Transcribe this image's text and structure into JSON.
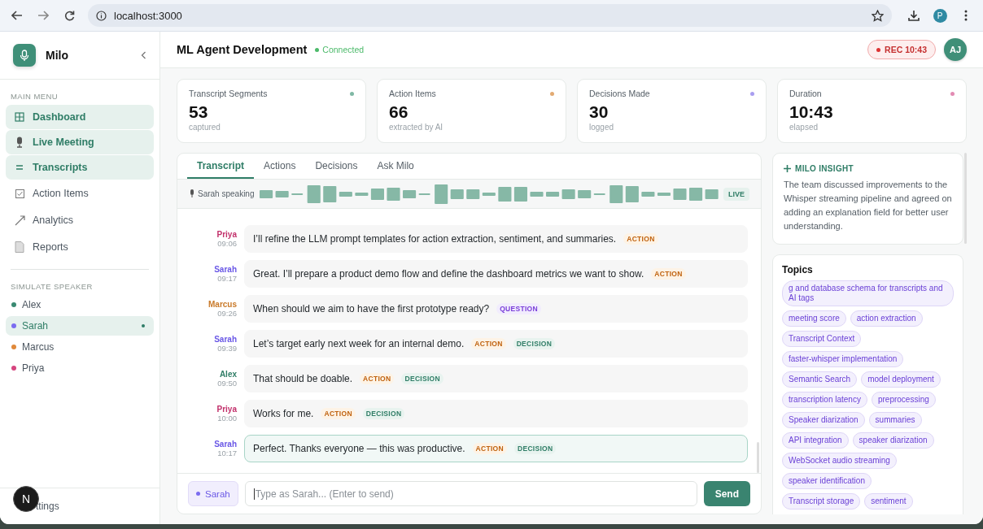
{
  "browser": {
    "url": "localhost:3000",
    "profile": "P"
  },
  "sidebar": {
    "app_name": "Milo",
    "menu_heading": "MAIN MENU",
    "items": [
      {
        "label": "Dashboard",
        "kind": "grid",
        "selected": true
      },
      {
        "label": "Live Meeting",
        "kind": "mic",
        "selected": true
      },
      {
        "label": "Transcripts",
        "kind": "lines",
        "selected": true
      },
      {
        "label": "Action Items",
        "kind": "check",
        "selected": false
      },
      {
        "label": "Analytics",
        "kind": "trend",
        "selected": false
      },
      {
        "label": "Reports",
        "kind": "doc",
        "selected": false
      }
    ],
    "speaker_heading": "SIMULATE SPEAKER",
    "speakers": [
      {
        "name": "Alex",
        "color": "#3a8a72",
        "selected": false
      },
      {
        "name": "Sarah",
        "color": "#7b6cf0",
        "selected": true
      },
      {
        "name": "Marcus",
        "color": "#e0893a",
        "selected": false
      },
      {
        "name": "Priya",
        "color": "#d6457f",
        "selected": false
      }
    ],
    "footer_item": "ttings",
    "dev_badge": "N"
  },
  "header": {
    "title": "ML Agent Development",
    "status": "Connected",
    "recording": "REC 10:43",
    "avatar": "AJ"
  },
  "stats": [
    {
      "label": "Transcript Segments",
      "value": "53",
      "caption": "captured",
      "color": "#7fb8a4"
    },
    {
      "label": "Action Items",
      "value": "66",
      "caption": "extracted by AI",
      "color": "#e2aa72"
    },
    {
      "label": "Decisions Made",
      "value": "30",
      "caption": "logged",
      "color": "#a99ef0"
    },
    {
      "label": "Duration",
      "value": "10:43",
      "caption": "elapsed",
      "color": "#e28bb3"
    }
  ],
  "transcript": {
    "tabs": [
      {
        "label": "Transcript",
        "selected": true
      },
      {
        "label": "Actions",
        "selected": false
      },
      {
        "label": "Decisions",
        "selected": false
      },
      {
        "label": "Ask Milo",
        "selected": false
      }
    ],
    "speaking": "Sarah speaking",
    "live": "LIVE",
    "messages": [
      {
        "speaker": "Priya",
        "time": "09:06",
        "color": "#c2306b",
        "text": "I’ll refine the LLM prompt templates for action extraction, sentiment, and summaries.",
        "highlighted": false,
        "tags": [
          {
            "kind": "action",
            "label": "ACTION"
          }
        ]
      },
      {
        "speaker": "Sarah",
        "time": "09:17",
        "color": "#6a58e6",
        "text": "Great. I’ll prepare a product demo flow and define the dashboard metrics we want to show.",
        "highlighted": false,
        "tags": [
          {
            "kind": "action",
            "label": "ACTION"
          }
        ]
      },
      {
        "speaker": "Marcus",
        "time": "09:26",
        "color": "#c97a2a",
        "text": "When should we aim to have the first prototype ready?",
        "highlighted": false,
        "tags": [
          {
            "kind": "question",
            "label": "QUESTION"
          }
        ]
      },
      {
        "speaker": "Sarah",
        "time": "09:39",
        "color": "#6a58e6",
        "text": "Let’s target early next week for an internal demo.",
        "highlighted": false,
        "tags": [
          {
            "kind": "action",
            "label": "ACTION"
          },
          {
            "kind": "decision",
            "label": "DECISION"
          }
        ]
      },
      {
        "speaker": "Alex",
        "time": "09:50",
        "color": "#2f7d66",
        "text": "That should be doable.",
        "highlighted": false,
        "tags": [
          {
            "kind": "action",
            "label": "ACTION"
          },
          {
            "kind": "decision",
            "label": "DECISION"
          }
        ]
      },
      {
        "speaker": "Priya",
        "time": "10:00",
        "color": "#c2306b",
        "text": "Works for me.",
        "highlighted": false,
        "tags": [
          {
            "kind": "action",
            "label": "ACTION"
          },
          {
            "kind": "decision",
            "label": "DECISION"
          }
        ]
      },
      {
        "speaker": "Sarah",
        "time": "10:17",
        "color": "#6a58e6",
        "text": "Perfect. Thanks everyone — this was productive.",
        "highlighted": true,
        "tags": [
          {
            "kind": "action",
            "label": "ACTION"
          },
          {
            "kind": "decision",
            "label": "DECISION"
          }
        ]
      }
    ],
    "input": {
      "speaker": "Sarah",
      "color": "#7b6cf0",
      "placeholder": "Type as Sarah... (Enter to send)"
    },
    "send": "Send"
  },
  "insight": {
    "heading": "MILO INSIGHT",
    "text": "The team discussed improvements to the Whisper streaming pipeline and agreed on adding an explanation field for better user understanding."
  },
  "topics": {
    "heading": "Topics",
    "items": [
      "g and database schema for transcripts and AI tags",
      "meeting score",
      "action extraction",
      "Transcript Context",
      "faster-whisper implementation",
      "Semantic Search",
      "model deployment",
      "transcription latency",
      "preprocessing",
      "Speaker diarization",
      "summaries",
      "API integration",
      "speaker diarization",
      "WebSocket audio streaming",
      "speaker identification",
      "Transcript storage",
      "sentiment"
    ]
  }
}
